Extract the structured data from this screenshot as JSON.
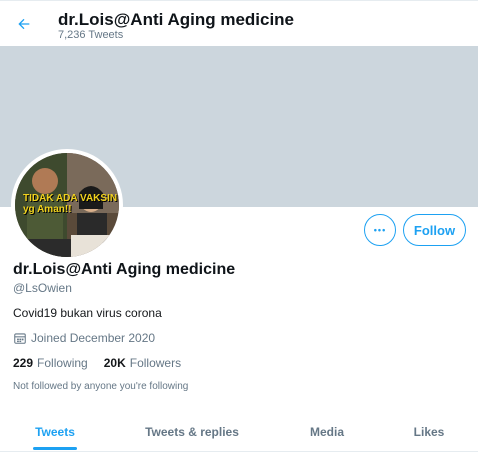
{
  "header": {
    "title": "dr.Lois@Anti Aging medicine",
    "tweet_count": "7,236 Tweets"
  },
  "avatar": {
    "overlay_text": "TIDAK ADA VAKSIN yg Aman!!"
  },
  "profile": {
    "name": "dr.Lois@Anti Aging medicine",
    "handle": "@LsOwien",
    "bio": "Covid19 bukan virus corona",
    "joined": "Joined December 2020",
    "following_count": "229",
    "following_label": "Following",
    "followers_count": "20K",
    "followers_label": "Followers",
    "not_followed": "Not followed by anyone you're following"
  },
  "actions": {
    "more_label": "•••",
    "follow_label": "Follow"
  },
  "tabs": [
    {
      "label": "Tweets",
      "active": true
    },
    {
      "label": "Tweets & replies",
      "active": false
    },
    {
      "label": "Media",
      "active": false
    },
    {
      "label": "Likes",
      "active": false
    }
  ],
  "colors": {
    "accent": "#1da1f2",
    "banner": "#ccd6dd",
    "secondary_text": "#657786"
  }
}
